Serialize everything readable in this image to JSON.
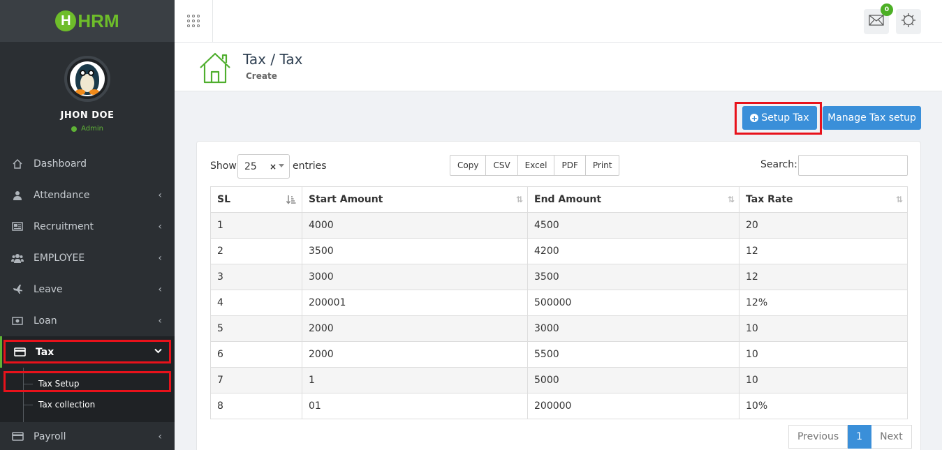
{
  "app": {
    "logo_text": "HRM",
    "logo_letter": "H"
  },
  "user": {
    "name": "JHON DOE",
    "role": "Admin"
  },
  "sidebar": {
    "items": [
      {
        "label": "Dashboard",
        "icon": "home-icon"
      },
      {
        "label": "Attendance",
        "icon": "user-icon"
      },
      {
        "label": "Recruitment",
        "icon": "newspaper-icon"
      },
      {
        "label": "EMPLOYEE",
        "icon": "users-icon"
      },
      {
        "label": "Leave",
        "icon": "plane-icon"
      },
      {
        "label": "Loan",
        "icon": "money-icon"
      },
      {
        "label": "Tax",
        "icon": "credit-card-icon"
      }
    ],
    "tax_submenu": [
      "Tax Setup",
      "Tax collection"
    ],
    "bottom_item": {
      "label": "Payroll",
      "icon": "credit-card-icon"
    }
  },
  "topbar": {
    "notification_count": "0"
  },
  "header": {
    "title": "Tax / Tax",
    "subtitle": "Create"
  },
  "actions": {
    "setup_tax": "Setup Tax",
    "manage_tax": "Manage Tax setup"
  },
  "table_controls": {
    "show_label": "Show",
    "page_length": "25",
    "entries_label": "entries",
    "export_buttons": [
      "Copy",
      "CSV",
      "Excel",
      "PDF",
      "Print"
    ],
    "search_label": "Search:"
  },
  "table": {
    "headers": [
      "SL",
      "Start Amount",
      "End Amount",
      "Tax Rate"
    ],
    "rows": [
      [
        "1",
        "4000",
        "4500",
        "20"
      ],
      [
        "2",
        "3500",
        "4200",
        "12"
      ],
      [
        "3",
        "3000",
        "3500",
        "12"
      ],
      [
        "4",
        "200001",
        "500000",
        "12%"
      ],
      [
        "5",
        "2000",
        "3000",
        "10"
      ],
      [
        "6",
        "2000",
        "5500",
        "10"
      ],
      [
        "7",
        "1",
        "5000",
        "10"
      ],
      [
        "8",
        "01",
        "200000",
        "10%"
      ]
    ]
  },
  "pagination": {
    "previous": "Previous",
    "current": "1",
    "next": "Next"
  },
  "colors": {
    "accent": "#3a8fd9",
    "brand_green": "#6ebd2a",
    "highlight": "#e8121b",
    "sidebar_bg": "#2b2f33"
  }
}
